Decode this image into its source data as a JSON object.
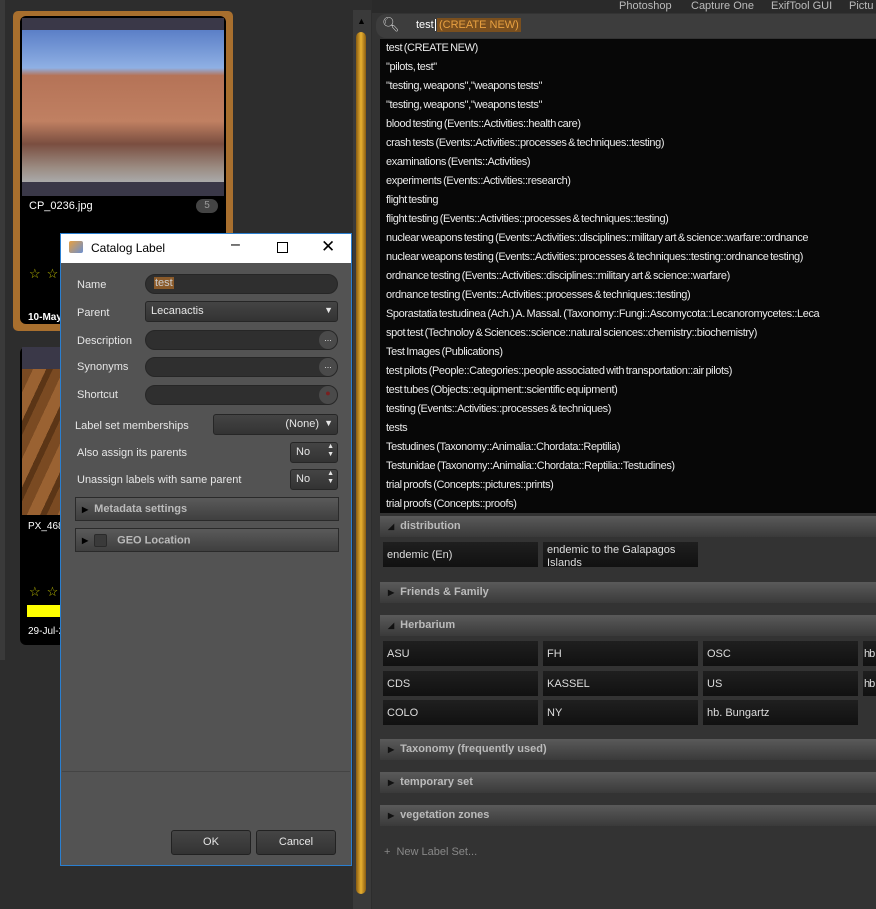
{
  "thumbnails": [
    {
      "filename": "CP_0236.jpg",
      "badge": "5",
      "date": "10-May"
    },
    {
      "filename": "PX_468",
      "date": "29-Jul-2"
    }
  ],
  "dialog": {
    "title": "Catalog Label",
    "fields": {
      "name_label": "Name",
      "name_value": "test",
      "parent_label": "Parent",
      "parent_value": "Lecanactis",
      "description_label": "Description",
      "synonyms_label": "Synonyms",
      "shortcut_label": "Shortcut",
      "more_button": "...",
      "label_set_label": "Label set memberships",
      "label_set_value": "(None)",
      "assign_parents_label": "Also assign its parents",
      "assign_parents_value": "No",
      "unassign_label": "Unassign labels with same parent",
      "unassign_value": "No"
    },
    "sections": [
      "Metadata settings",
      "GEO Location"
    ],
    "ok": "OK",
    "cancel": "Cancel"
  },
  "menu": [
    "Photoshop",
    "Capture One",
    "ExifTool GUI",
    "Pictu"
  ],
  "search": {
    "value": "test",
    "suggestion": "(CREATE NEW)"
  },
  "dropdown": [
    "test (CREATE NEW)",
    "\"pilots, test\"",
    "\"testing, weapons\",\"weapons tests\"",
    "\"testing, weapons\",\"weapons tests\"",
    "blood testing (Events::Activities::health care)",
    "crash tests (Events::Activities::processes & techniques::testing)",
    "examinations (Events::Activities)",
    "experiments (Events::Activities::research)",
    "flight testing",
    "flight testing (Events::Activities::processes & techniques::testing)",
    "nuclear weapons testing (Events::Activities::disciplines::military art & science::warfare::ordnance",
    "nuclear weapons testing (Events::Activities::processes & techniques::testing::ordnance testing)",
    "ordnance testing (Events::Activities::disciplines::military art & science::warfare)",
    "ordnance testing (Events::Activities::processes & techniques::testing)",
    "Sporastatia testudinea (Ach.) A. Massal. (Taxonomy::Fungi::Ascomycota::Lecanoromycetes::Leca",
    "spot test (Technoloy & Sciences::science::natural sciences::chemistry::biochemistry)",
    "Test Images (Publications)",
    "test pilots (People::Categories::people associated with transportation::air pilots)",
    "test tubes (Objects::equipment::scientific equipment)",
    "testing (Events::Activities::processes & techniques)",
    "tests",
    "Testudines (Taxonomy::Animalia::Chordata::Reptilia)",
    "Testunidae (Taxonomy::Animalia::Chordata::Reptilia::Testudines)",
    "trial proofs (Concepts::pictures::prints)",
    "trial proofs (Concepts::proofs)"
  ],
  "label_sets": {
    "distribution": {
      "title": "distribution",
      "cells": [
        "endemic (En)",
        "endemic to the Galapagos Islands"
      ]
    },
    "friends": "Friends & Family",
    "herbarium": {
      "title": "Herbarium",
      "cells": [
        "ASU",
        "FH",
        "OSC",
        "hb",
        "CDS",
        "KASSEL",
        "US",
        "hb",
        "COLO",
        "NY",
        "hb. Bungartz"
      ]
    },
    "taxonomy": "Taxonomy (frequently used)",
    "temporary": "temporary set",
    "vegetation": "vegetation zones",
    "new_set": "New Label Set..."
  },
  "colors": {
    "accent": "#d9a12c",
    "selection": "#8a5a2a",
    "highlight_bar": "#ffff00"
  }
}
